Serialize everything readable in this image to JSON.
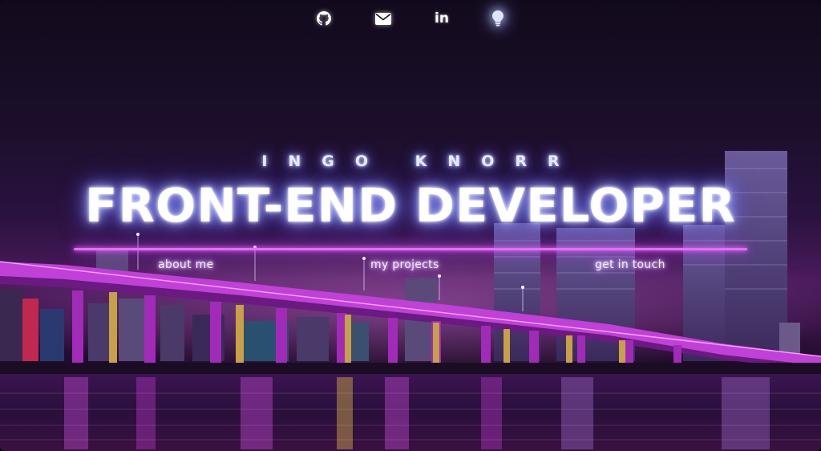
{
  "social": [
    {
      "icon": "github-icon"
    },
    {
      "icon": "envelope-icon"
    },
    {
      "icon": "linkedin-icon",
      "glyph": "in"
    },
    {
      "icon": "lightbulb-icon"
    }
  ],
  "hero": {
    "name": "INGO KNORR",
    "title": "FRONT-END DEVELOPER"
  },
  "nav": {
    "about": "about me",
    "projects": "my projects",
    "contact": "get in touch"
  },
  "colors": {
    "neon_pink": "#e86bff",
    "neon_blue": "#7a86ff",
    "sky": "#120a1c",
    "bridge": "#c040d8"
  }
}
